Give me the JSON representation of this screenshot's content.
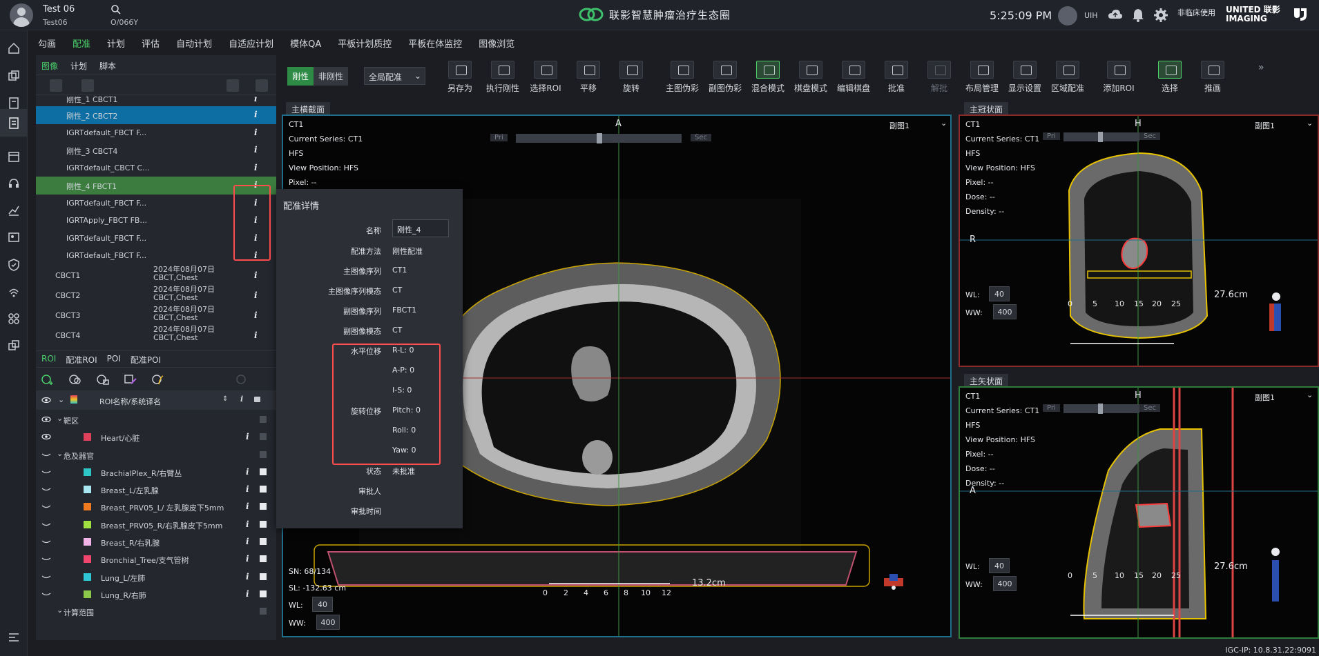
{
  "header": {
    "patient_name": "Test 06",
    "patient_id": "Test06",
    "patient_code": "O/066Y",
    "app_title": "联影智慧肿瘤治疗生态圈",
    "time": "5:25:09 PM",
    "user": "UIH",
    "nonclinical": "非临床使用",
    "brand_line1": "UNITED 联影",
    "brand_line2": "IMAGING"
  },
  "menu": [
    "勾画",
    "配准",
    "计划",
    "评估",
    "自动计划",
    "自适应计划",
    "模体QA",
    "平板计划质控",
    "平板在体监控",
    "图像浏览"
  ],
  "left_tabs": [
    "图像",
    "计划",
    "脚本"
  ],
  "series": [
    {
      "name": "刚性_1   CBCT1",
      "info": "i",
      "style": ""
    },
    {
      "name": "刚性_2   CBCT2",
      "info": "i",
      "style": "sel-blue"
    },
    {
      "name": "IGRTdefault_FBCT   F...",
      "info": "i",
      "style": ""
    },
    {
      "name": "刚性_3   CBCT4",
      "info": "i",
      "style": ""
    },
    {
      "name": "IGRTdefault_CBCT   C...",
      "info": "i",
      "style": ""
    },
    {
      "name": "刚性_4   FBCT1",
      "info": "i",
      "style": "sel-green"
    },
    {
      "name": "IGRTdefault_FBCT   F...",
      "info": "i",
      "style": ""
    },
    {
      "name": "IGRTApply_FBCT   FB...",
      "info": "i",
      "style": ""
    },
    {
      "name": "IGRTdefault_FBCT   F...",
      "info": "i",
      "style": ""
    },
    {
      "name": "IGRTdefault_FBCT   F...",
      "info": "i",
      "style": ""
    }
  ],
  "groups": [
    {
      "name": "CBCT1",
      "date": "2024年08月07日",
      "desc": "CBCT,Chest",
      "info": "i"
    },
    {
      "name": "CBCT2",
      "date": "2024年08月07日",
      "desc": "CBCT,Chest",
      "info": "i"
    },
    {
      "name": "CBCT3",
      "date": "2024年08月07日",
      "desc": "CBCT,Chest",
      "info": "i"
    },
    {
      "name": "CBCT4",
      "date": "2024年08月07日",
      "desc": "CBCT,Chest",
      "info": "i"
    }
  ],
  "roi_tabs": [
    "ROI",
    "配准ROI",
    "POI",
    "配准POI"
  ],
  "roi_header": "ROI名称/系统译名",
  "roi_groups": [
    {
      "name": "靶区",
      "items": [
        {
          "name": "Heart/心脏",
          "color": "#e0415a"
        }
      ]
    },
    {
      "name": "危及器官",
      "items": [
        {
          "name": "BrachialPlex_R/右臂丛",
          "color": "#2fc6c6"
        },
        {
          "name": "Breast_L/左乳腺",
          "color": "#a8e6f0"
        },
        {
          "name": "Breast_PRV05_L/ 左乳腺皮下5mm",
          "color": "#f07a1f"
        },
        {
          "name": "Breast_PRV05_R/右乳腺皮下5mm",
          "color": "#a0e040"
        },
        {
          "name": "Breast_R/右乳腺",
          "color": "#f0b4e8"
        },
        {
          "name": "Bronchial_Tree/支气管树",
          "color": "#f0466e"
        },
        {
          "name": "Lung_L/左肺",
          "color": "#2fc6d6"
        },
        {
          "name": "Lung_R/右肺",
          "color": "#8cc84a"
        }
      ]
    },
    {
      "name": "计算范围",
      "items": []
    }
  ],
  "toolbar": {
    "rigid": "刚性",
    "nonrigid": "非刚性",
    "scope": "全局配准",
    "tools": [
      {
        "label": "另存为",
        "on": false,
        "dim": false
      },
      {
        "label": "执行刚性",
        "on": false,
        "dim": false
      },
      {
        "label": "选择ROI",
        "on": false,
        "dim": false
      },
      {
        "label": "平移",
        "on": false,
        "dim": false
      },
      {
        "label": "旋转",
        "on": false,
        "dim": false
      },
      {
        "label": "主图伪彩",
        "on": false,
        "dim": false
      },
      {
        "label": "副图伪彩",
        "on": false,
        "dim": false
      },
      {
        "label": "混合模式",
        "on": true,
        "dim": false
      },
      {
        "label": "棋盘模式",
        "on": false,
        "dim": false
      },
      {
        "label": "编辑棋盘",
        "on": false,
        "dim": false
      },
      {
        "label": "批准",
        "on": false,
        "dim": false
      },
      {
        "label": "解批",
        "on": false,
        "dim": true
      },
      {
        "label": "布局管理",
        "on": false,
        "dim": false
      },
      {
        "label": "显示设置",
        "on": false,
        "dim": false
      },
      {
        "label": "区域配准",
        "on": false,
        "dim": false
      },
      {
        "label": "添加ROI",
        "on": false,
        "dim": false
      },
      {
        "label": "选择",
        "on": true,
        "dim": false
      },
      {
        "label": "推画",
        "on": false,
        "dim": false
      }
    ]
  },
  "viewports": {
    "main": {
      "tab": "主横截面",
      "series": "CT1",
      "current_series": "Current Series: CT1",
      "hfs": "HFS",
      "view_position": "View Position: HFS",
      "pixel": "Pixel:  --",
      "orient": "A",
      "sec_image": "副图1",
      "pri": "Pri",
      "sec": "Sec",
      "sn": "SN: 68/134",
      "sl": "SL: -132.63 cm",
      "wl_label": "WL:",
      "wl": "40",
      "ww_label": "WW:",
      "ww": "400",
      "scale": "13.2cm",
      "ticks": [
        "0",
        "2",
        "4",
        "6",
        "8",
        "10",
        "12"
      ]
    },
    "coronal": {
      "tab": "主冠状面",
      "series": "CT1",
      "current_series": "Current Series: CT1",
      "hfs": "HFS",
      "view_position": "View Position: HFS",
      "pixel": "Pixel:  --",
      "dose": "Dose:  --",
      "density": "Density:  --",
      "orient": "H",
      "left": "R",
      "sec_image": "副图1",
      "pri": "Pri",
      "sec": "Sec",
      "wl_label": "WL:",
      "wl": "40",
      "ww_label": "WW:",
      "ww": "400",
      "scale": "27.6cm",
      "ticks": [
        "0",
        "5",
        "10",
        "15",
        "20",
        "25"
      ]
    },
    "sagittal": {
      "tab": "主矢状面",
      "series": "CT1",
      "current_series": "Current Series: CT1",
      "hfs": "HFS",
      "view_position": "View Position: HFS",
      "pixel": "Pixel:  --",
      "dose": "Dose:  --",
      "density": "Density:  --",
      "orient": "H",
      "left": "A",
      "sec_image": "副图1",
      "pri": "Pri",
      "sec": "Sec",
      "wl_label": "WL:",
      "wl": "40",
      "ww_label": "WW:",
      "ww": "400",
      "scale": "27.6cm",
      "ticks": [
        "0",
        "5",
        "10",
        "15",
        "20",
        "25"
      ]
    }
  },
  "popup": {
    "title": "配准详情",
    "rows": [
      {
        "k": "名称",
        "v": ""
      },
      {
        "k": "配准方法",
        "v": "刚性配准"
      },
      {
        "k": "主图像序列",
        "v": "CT1"
      },
      {
        "k": "主图像序列模态",
        "v": "CT"
      },
      {
        "k": "副图像序列",
        "v": "FBCT1"
      },
      {
        "k": "副图像模态",
        "v": "CT"
      },
      {
        "k": "水平位移",
        "v": "R-L: 0"
      },
      {
        "k": "",
        "v": "A-P: 0"
      },
      {
        "k": "",
        "v": "I-S: 0"
      },
      {
        "k": "旋转位移",
        "v": "Pitch: 0"
      },
      {
        "k": "",
        "v": "Roll: 0"
      },
      {
        "k": "",
        "v": "Yaw: 0"
      },
      {
        "k": "状态",
        "v": "未批准"
      },
      {
        "k": "审批人",
        "v": ""
      },
      {
        "k": "审批时间",
        "v": ""
      }
    ],
    "name_value": "刚性_4"
  },
  "status": "IGC-IP: 10.8.31.22:9091"
}
